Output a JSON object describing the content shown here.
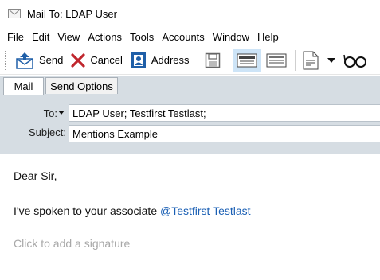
{
  "window": {
    "title": "Mail To: LDAP User"
  },
  "menu": {
    "items": [
      "File",
      "Edit",
      "View",
      "Actions",
      "Tools",
      "Accounts",
      "Window",
      "Help"
    ]
  },
  "toolbar": {
    "send_label": "Send",
    "cancel_label": "Cancel",
    "address_label": "Address"
  },
  "tabs": {
    "mail": "Mail",
    "send_options": "Send Options"
  },
  "header": {
    "to_label": "To:",
    "to_value": "LDAP User;  Testfirst Testlast;",
    "subject_label": "Subject:",
    "subject_value": "Mentions Example"
  },
  "body": {
    "greeting": "Dear Sir,",
    "sentence_prefix": "I've spoken to your associate ",
    "mention": "@Testfirst Testlast ",
    "signature_placeholder": "Click to add a signature"
  },
  "colors": {
    "accent_red": "#c0262d",
    "accent_blue": "#1f5fa8",
    "header_bg": "#d6dde3",
    "mention_link": "#1a5fb4"
  }
}
